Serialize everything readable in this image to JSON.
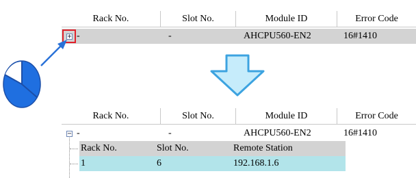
{
  "before_grid": {
    "columns": [
      "Rack No.",
      "Slot No.",
      "Module ID",
      "Error Code"
    ],
    "row": {
      "expander_symbol": "+",
      "rack": "-",
      "slot": "-",
      "module_id": "AHCPU560-EN2",
      "error_code": "16#1410"
    }
  },
  "after_grid": {
    "columns": [
      "Rack No.",
      "Slot No.",
      "Module ID",
      "Error Code"
    ],
    "row": {
      "expander_symbol": "−",
      "rack": "-",
      "slot": "-",
      "module_id": "AHCPU560-EN2",
      "error_code": "16#1410"
    },
    "sub_columns": [
      "Rack No.",
      "Slot No.",
      "Remote Station"
    ],
    "sub_row": {
      "rack": "1",
      "slot": "6",
      "remote_station": "192.168.1.6"
    }
  },
  "colors": {
    "highlight_box": "#e0202a",
    "pointer_arrow": "#2a72d8",
    "mouse_fill": "#1f6fe0",
    "down_arrow_fill": "#c6ecfb",
    "down_arrow_stroke": "#3da3e0",
    "gray_row": "#d3d3d3",
    "cyan_row": "#b2e4ea"
  },
  "icons": {
    "mouse": "mouse-left-click-icon",
    "pointer": "pointer-arrow-icon",
    "down_arrow": "down-arrow-icon"
  }
}
